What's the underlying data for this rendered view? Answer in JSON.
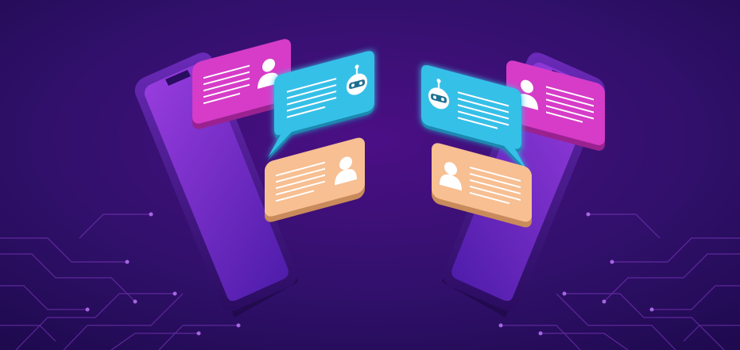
{
  "scene": {
    "colors": {
      "background_top": "#2c0b6b",
      "background_bottom": "#4a0c7a",
      "phone_body": "#3a0f7a",
      "phone_screen": "#7a2fd6",
      "bubble_magenta": "#d63cc8",
      "bubble_cyan": "#2fb8e0",
      "bubble_peach": "#f5b98c",
      "circuit": "#9a4ad8"
    },
    "icons": [
      "user-icon",
      "robot-icon"
    ]
  }
}
